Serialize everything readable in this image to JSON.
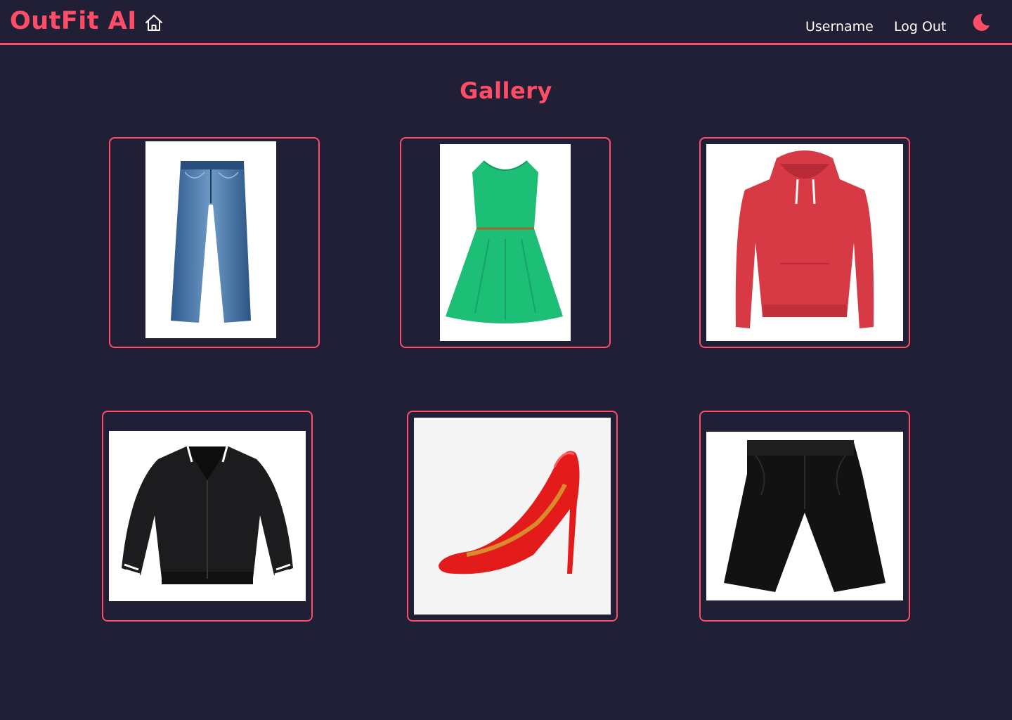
{
  "header": {
    "brand": "OutFit AI",
    "home_icon": "home-icon",
    "username": "Username",
    "logout": "Log Out",
    "theme_icon": "moon-icon"
  },
  "page": {
    "title": "Gallery"
  },
  "gallery": {
    "items": [
      {
        "item": "jeans"
      },
      {
        "item": "green-dress"
      },
      {
        "item": "red-hoodie"
      },
      {
        "item": "bomber-jacket"
      },
      {
        "item": "red-heel"
      },
      {
        "item": "black-shorts"
      }
    ]
  },
  "colors": {
    "background": "#201f35",
    "accent": "#ff4d67",
    "text": "#ffffff"
  }
}
